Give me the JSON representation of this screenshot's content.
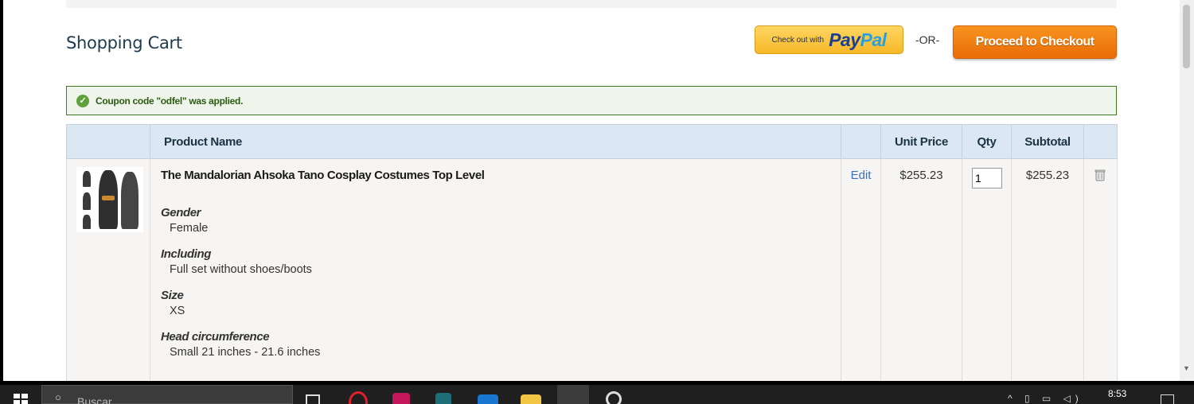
{
  "page": {
    "title": "Shopping Cart",
    "or_text": "-OR-",
    "checkout_label": "Proceed to Checkout"
  },
  "paypal": {
    "small_text": "Check out with",
    "logo_pay": "Pay",
    "logo_pal": "Pal"
  },
  "notice": {
    "message": "Coupon code \"odfel\" was applied."
  },
  "table": {
    "headers": {
      "product_name": "Product Name",
      "unit_price": "Unit Price",
      "qty": "Qty",
      "subtotal": "Subtotal"
    },
    "items": [
      {
        "name": "The Mandalorian Ahsoka Tano Cosplay Costumes Top Level",
        "edit_label": "Edit",
        "unit_price": "$255.23",
        "qty": "1",
        "subtotal": "$255.23",
        "options": [
          {
            "label": "Gender",
            "value": "Female"
          },
          {
            "label": "Including",
            "value": "Full set without shoes/boots"
          },
          {
            "label": "Size",
            "value": "XS"
          },
          {
            "label": "Head circumference",
            "value": "Small 21 inches - 21.6 inches"
          }
        ]
      }
    ]
  },
  "taskbar": {
    "search_placeholder": "Buscar",
    "time": "8:53"
  },
  "colors": {
    "accent_orange": "#e96c06",
    "header_blue": "#dbe7f2",
    "success_green": "#3d7a23",
    "link_blue": "#3a72b5"
  }
}
